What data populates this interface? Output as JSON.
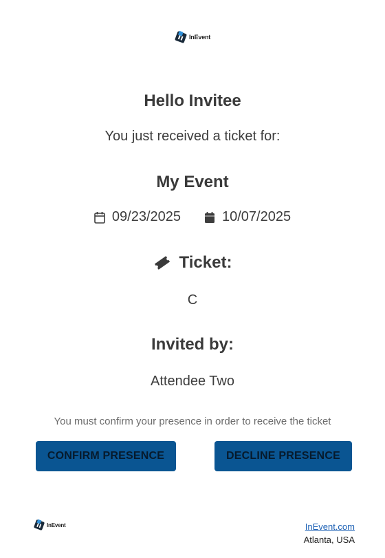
{
  "brand": {
    "name": "InEvent",
    "accent_color": "#0a5592"
  },
  "greeting": "Hello Invitee",
  "intro": "You just received a ticket for:",
  "event": {
    "name": "My Event",
    "start_date": "09/23/2025",
    "end_date": "10/07/2025",
    "start_icon": "calendar-outline-icon",
    "end_icon": "calendar-filled-icon"
  },
  "ticket": {
    "heading": "Ticket:",
    "value": "C",
    "icon": "ticket-icon"
  },
  "invited_by": {
    "heading": "Invited by:",
    "name": "Attendee Two"
  },
  "confirm_note": "You must confirm your presence in order to receive the ticket",
  "buttons": {
    "confirm": "CONFIRM PRESENCE",
    "decline": "DECLINE PRESENCE"
  },
  "footer": {
    "link_text": "InEvent.com",
    "location": "Atlanta, USA"
  }
}
